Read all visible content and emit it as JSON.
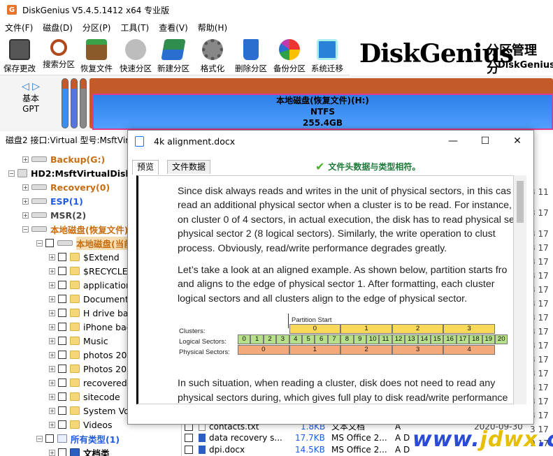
{
  "app": {
    "title": "DiskGenius V5.4.5.1412 x64 专业版",
    "icon_letter": "G"
  },
  "menu": [
    "文件(F)",
    "磁盘(D)",
    "分区(P)",
    "工具(T)",
    "查看(V)",
    "帮助(H)"
  ],
  "toolbar": [
    {
      "label": "保存更改",
      "icon": "save-icon",
      "color": "#555"
    },
    {
      "label": "搜索分区",
      "icon": "magnifier-icon",
      "color": "#b04a1e"
    },
    {
      "label": "恢复文件",
      "icon": "recover-box-icon",
      "color": "#7a4a1e"
    },
    {
      "label": "快速分区",
      "icon": "disk-icon",
      "color": "#9a9a9a"
    },
    {
      "label": "新建分区",
      "icon": "layers-icon",
      "color": "#2f8e4e"
    },
    {
      "label": "格式化",
      "icon": "format-gear-icon",
      "color": "#777"
    },
    {
      "label": "删除分区",
      "icon": "trash-icon",
      "color": "#2a6fd0"
    },
    {
      "label": "备份分区",
      "icon": "pie-icon",
      "color": "#c23ab2"
    },
    {
      "label": "系统迁移",
      "icon": "windows-migrate-icon",
      "color": "#2a82d8"
    }
  ],
  "brand": {
    "logo": "DiskGenius",
    "right1": "分区管理 分",
    "right2": "DiskGenius"
  },
  "disk": {
    "line1": "基本",
    "line2": "GPT",
    "partition_name": "本地磁盘(恢复文件)(H:)",
    "fs": "NTFS",
    "size": "255.4GB"
  },
  "infoline": "磁盘2 接口:Virtual  型号:MsftVir",
  "tree": [
    {
      "text": "Backup(G:)",
      "style": "orange"
    },
    {
      "text": "HD2:MsftVirtualDisk(",
      "style": "plain"
    },
    {
      "text": "Recovery(0)",
      "style": "orange"
    },
    {
      "text": "ESP(1)",
      "style": "blue"
    },
    {
      "text": "MSR(2)",
      "style": "gray"
    },
    {
      "text": "本地磁盘(恢复文件)(",
      "style": "orange"
    },
    {
      "text": "本地磁盘(当前分",
      "style": "orange"
    },
    {
      "text": "$Extend",
      "style": "plain"
    },
    {
      "text": "$RECYCLE.",
      "style": "plain"
    },
    {
      "text": "application",
      "style": "plain"
    },
    {
      "text": "Documents",
      "style": "plain"
    },
    {
      "text": "H drive ba",
      "style": "plain"
    },
    {
      "text": "iPhone bac",
      "style": "plain"
    },
    {
      "text": "Music",
      "style": "plain"
    },
    {
      "text": "photos 202",
      "style": "plain"
    },
    {
      "text": "Photos 202",
      "style": "plain"
    },
    {
      "text": "recovered",
      "style": "plain"
    },
    {
      "text": "sitecode",
      "style": "plain"
    },
    {
      "text": "System Vo",
      "style": "plain"
    },
    {
      "text": "Videos",
      "style": "plain"
    },
    {
      "text": "所有类型(1)",
      "style": "blue"
    },
    {
      "text": "文档类",
      "style": "plain"
    }
  ],
  "filelist": [
    {
      "name": "contacts.txt",
      "size": "1.8KB",
      "type": "文本文档",
      "attr": "A",
      "date": "2020-09-30"
    },
    {
      "name": "data recovery s...",
      "size": "17.7KB",
      "type": "MS Office 2...",
      "attr": "A D",
      "date": ""
    },
    {
      "name": "dpi.docx",
      "size": "14.5KB",
      "type": "MS Office 2...",
      "attr": "A D",
      "date": ""
    }
  ],
  "right_times": [
    "3 11",
    "3 17",
    "3 17",
    "3 17",
    "3 17",
    "3 17",
    "3 17",
    "3 17",
    "3 17",
    "3 17",
    "3 17",
    "3 17",
    "3 17",
    "3 17",
    "3 17",
    "3 17",
    "3 17",
    "9 17"
  ],
  "dialog": {
    "title": "4k alignment.docx",
    "tab_preview": "预览",
    "tab_data": "文件数据",
    "match_msg": "文件头数据与类型相符。",
    "para1": [
      "Since disk always reads and writes in the unit of physical sectors, in this cas",
      "read an additional physical sector when a cluster is to be read. For instance, t",
      "on cluster 0 of 4 sectors, in actual execution, the disk has to read physical se",
      "physical sector 2 (8 logical sectors). Similarly, the write operation to clust",
      "process. Obviously, read/write performance degrades greatly."
    ],
    "para2": [
      "Let’s take a look at an aligned example. As shown below, partition starts fro",
      "and aligns to the edge of physical sector 1. After formatting, each cluster",
      "logical sectors and all clusters align to the edge of physical sector."
    ],
    "para3": [
      "In such situation, when reading a cluster, disk does not need to read any",
      "physical sectors during, which gives full play to disk read/write performance"
    ],
    "diagram": {
      "partition_start": "Partition Start",
      "row_clusters": "Clusters:",
      "row_logical": "Logical Sectors:",
      "row_physical": "Physical Sectors:",
      "clusters": [
        "0",
        "1",
        "2",
        "3"
      ],
      "logical": [
        "0",
        "1",
        "2",
        "3",
        "4",
        "5",
        "6",
        "7",
        "8",
        "9",
        "10",
        "11",
        "12",
        "13",
        "14",
        "15",
        "16",
        "17",
        "18",
        "19",
        "20"
      ],
      "physical": [
        "0",
        "1",
        "2",
        "3",
        "4"
      ]
    }
  },
  "watermark": {
    "prefix": "www.",
    "main": "jdwx",
    "suffix": ".cn"
  }
}
